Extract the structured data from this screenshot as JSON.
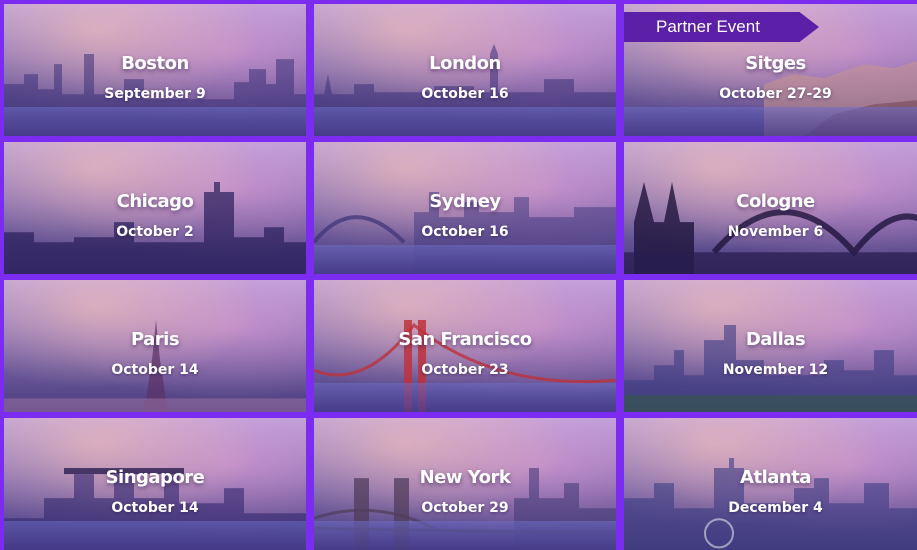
{
  "events": [
    {
      "city": "Boston",
      "date": "September 9"
    },
    {
      "city": "London",
      "date": "October 16"
    },
    {
      "city": "Sitges",
      "date": "October 27-29",
      "badge": "Partner Event"
    },
    {
      "city": "Chicago",
      "date": "October 2"
    },
    {
      "city": "Sydney",
      "date": "October 16"
    },
    {
      "city": "Cologne",
      "date": "November 6"
    },
    {
      "city": "Paris",
      "date": "October 14"
    },
    {
      "city": "San Francisco",
      "date": "October 23"
    },
    {
      "city": "Dallas",
      "date": "November 12"
    },
    {
      "city": "Singapore",
      "date": "October 14"
    },
    {
      "city": "New York",
      "date": "October 29"
    },
    {
      "city": "Atlanta",
      "date": "December 4"
    }
  ],
  "colors": {
    "background": "#7b2cf0",
    "badge": "#5b1fa8",
    "text": "#ffffff"
  }
}
